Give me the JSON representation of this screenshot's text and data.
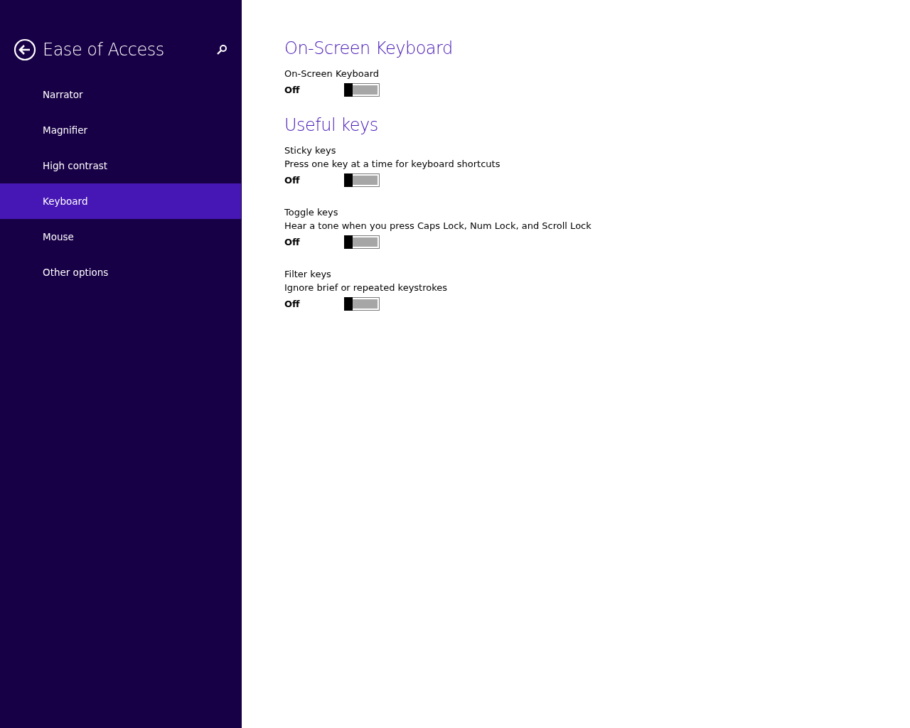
{
  "sidebar": {
    "title": "Ease of Access",
    "items": [
      {
        "label": "Narrator",
        "selected": false
      },
      {
        "label": "Magnifier",
        "selected": false
      },
      {
        "label": "High contrast",
        "selected": false
      },
      {
        "label": "Keyboard",
        "selected": true
      },
      {
        "label": "Mouse",
        "selected": false
      },
      {
        "label": "Other options",
        "selected": false
      }
    ]
  },
  "sections": [
    {
      "heading": "On-Screen Keyboard",
      "settings": [
        {
          "label": "On-Screen Keyboard",
          "state": "Off",
          "on": false
        }
      ]
    },
    {
      "heading": "Useful keys",
      "settings": [
        {
          "label": "Sticky keys",
          "description": "Press one key at a time for keyboard shortcuts",
          "state": "Off",
          "on": false
        },
        {
          "label": "Toggle keys",
          "description": "Hear a tone when you press Caps Lock, Num Lock, and Scroll Lock",
          "state": "Off",
          "on": false
        },
        {
          "label": "Filter keys",
          "description": "Ignore brief or repeated keystrokes",
          "state": "Off",
          "on": false
        }
      ]
    }
  ]
}
